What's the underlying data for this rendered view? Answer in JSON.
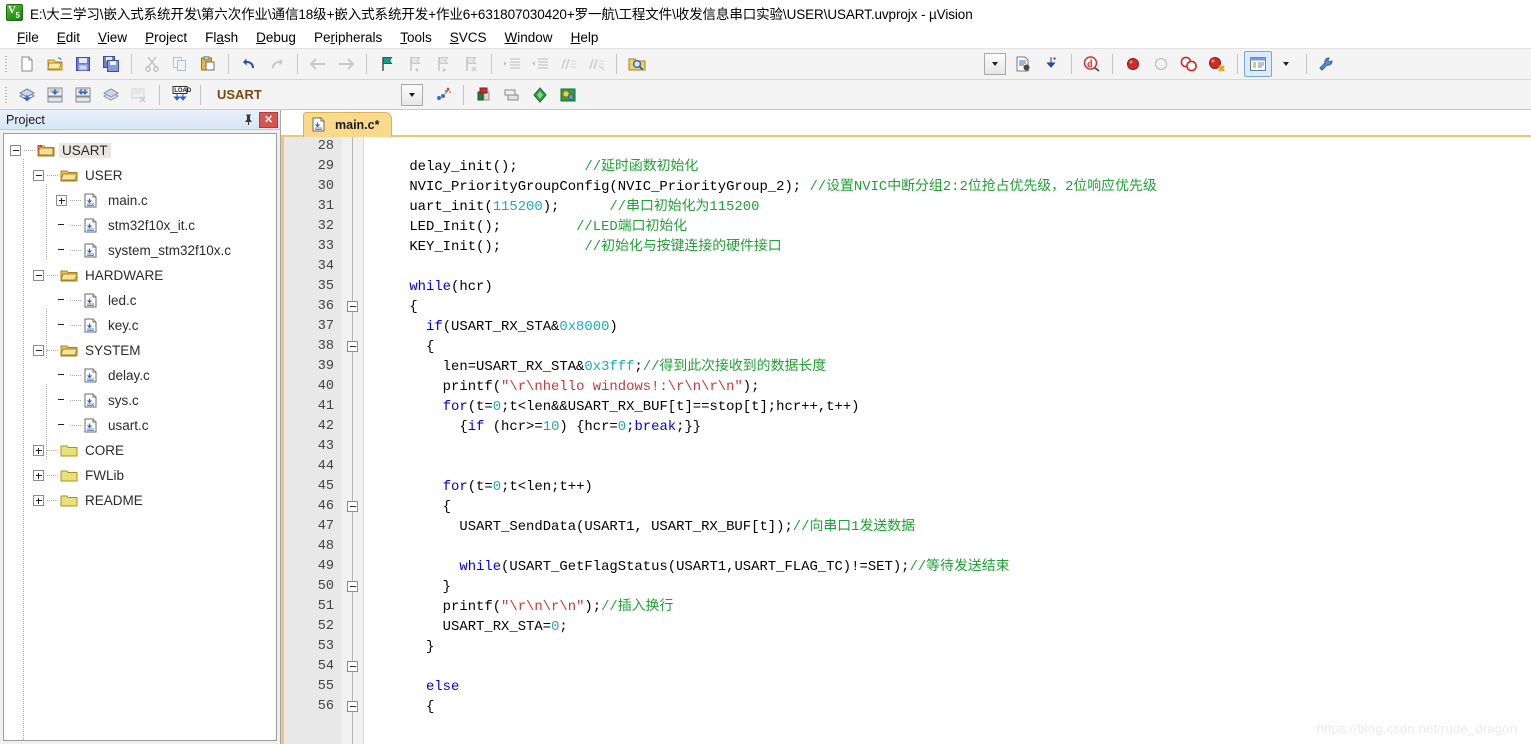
{
  "window": {
    "icon": "uvision-app-icon",
    "title": "E:\\大三学习\\嵌入式系统开发\\第六次作业\\通信18级+嵌入式系统开发+作业6+631807030420+罗一航\\工程文件\\收发信息串口实验\\USER\\USART.uvprojx - µVision"
  },
  "menubar": {
    "items": [
      {
        "label": "File",
        "name": "menu-file"
      },
      {
        "label": "Edit",
        "name": "menu-edit"
      },
      {
        "label": "View",
        "name": "menu-view"
      },
      {
        "label": "Project",
        "name": "menu-project"
      },
      {
        "label": "Flash",
        "name": "menu-flash"
      },
      {
        "label": "Debug",
        "name": "menu-debug"
      },
      {
        "label": "Peripherals",
        "name": "menu-peripherals"
      },
      {
        "label": "Tools",
        "name": "menu-tools"
      },
      {
        "label": "SVCS",
        "name": "menu-svcs"
      },
      {
        "label": "Window",
        "name": "menu-window"
      },
      {
        "label": "Help",
        "name": "menu-help"
      }
    ]
  },
  "toolbar_main": {
    "icons": [
      "new-file-icon",
      "open-file-icon",
      "save-icon",
      "save-all-icon",
      "cut-icon",
      "copy-icon",
      "paste-icon",
      "undo-icon",
      "redo-icon",
      "navigate-back-icon",
      "navigate-forward-icon",
      "bookmark-toggle-icon",
      "bookmark-prev-icon",
      "bookmark-next-icon",
      "bookmark-clear-icon",
      "indent-icon",
      "outdent-icon",
      "comment-icon",
      "uncomment-icon",
      "find-in-files-icon",
      "combo-dropdown-icon",
      "insert-file-icon",
      "configure-icon",
      "debug-session-icon",
      "breakpoint-insert-icon",
      "breakpoint-disable-icon",
      "breakpoint-disable-all-icon",
      "breakpoint-kill-all-icon",
      "project-window-icon",
      "project-window-dropdown-icon",
      "configure-target-icon"
    ]
  },
  "toolbar_build": {
    "icons": [
      "translate-icon",
      "build-target-icon",
      "rebuild-all-icon",
      "batch-build-icon",
      "stop-build-icon",
      "download-icon"
    ],
    "target_value": "USART",
    "target_dropdown": "target-dropdown-icon",
    "after_icons": [
      "target-options-icon",
      "manage-project-items-icon",
      "manage-multi-project-icon",
      "pack-installer-icon",
      "manage-run-time-env-icon"
    ]
  },
  "project_panel": {
    "title": "Project",
    "pin_icon": "pin-icon",
    "close_icon": "close-icon",
    "tree": [
      {
        "label": "USART",
        "depth": 0,
        "type": "project",
        "state": "expanded",
        "selected": true
      },
      {
        "label": "USER",
        "depth": 1,
        "type": "group",
        "state": "expanded",
        "selected": false
      },
      {
        "label": "main.c",
        "depth": 2,
        "type": "file",
        "state": "collapsed",
        "selected": false
      },
      {
        "label": "stm32f10x_it.c",
        "depth": 2,
        "type": "file",
        "state": "leaf",
        "selected": false
      },
      {
        "label": "system_stm32f10x.c",
        "depth": 2,
        "type": "file",
        "state": "leaf",
        "selected": false
      },
      {
        "label": "HARDWARE",
        "depth": 1,
        "type": "group",
        "state": "expanded",
        "selected": false
      },
      {
        "label": "led.c",
        "depth": 2,
        "type": "file",
        "state": "leaf",
        "selected": false
      },
      {
        "label": "key.c",
        "depth": 2,
        "type": "file",
        "state": "leaf",
        "selected": false
      },
      {
        "label": "SYSTEM",
        "depth": 1,
        "type": "group",
        "state": "expanded",
        "selected": false
      },
      {
        "label": "delay.c",
        "depth": 2,
        "type": "file",
        "state": "leaf",
        "selected": false
      },
      {
        "label": "sys.c",
        "depth": 2,
        "type": "file",
        "state": "leaf",
        "selected": false
      },
      {
        "label": "usart.c",
        "depth": 2,
        "type": "file",
        "state": "leaf",
        "selected": false
      },
      {
        "label": "CORE",
        "depth": 1,
        "type": "folder",
        "state": "collapsed",
        "selected": false
      },
      {
        "label": "FWLib",
        "depth": 1,
        "type": "folder",
        "state": "collapsed",
        "selected": false
      },
      {
        "label": "README",
        "depth": 1,
        "type": "folder",
        "state": "collapsed",
        "selected": false
      }
    ]
  },
  "editor": {
    "tabs": [
      {
        "label": "main.c*",
        "icon": "c-file-icon",
        "active": true
      }
    ],
    "first_line_number": 28,
    "fold_lines": [
      36,
      38,
      46,
      50,
      54,
      56
    ],
    "lines": [
      {
        "n": 28,
        "tokens": []
      },
      {
        "n": 29,
        "tokens": [
          {
            "t": "    delay_init();        ",
            "c": "plain"
          },
          {
            "t": "//延时函数初始化",
            "c": "cm"
          }
        ]
      },
      {
        "n": 30,
        "tokens": [
          {
            "t": "    NVIC_PriorityGroupConfig(NVIC_PriorityGroup_2); ",
            "c": "plain"
          },
          {
            "t": "//设置NVIC中断分组2:2位抢占优先级，2位响应优先级",
            "c": "cm"
          }
        ]
      },
      {
        "n": 31,
        "tokens": [
          {
            "t": "    uart_init(",
            "c": "plain"
          },
          {
            "t": "115200",
            "c": "num"
          },
          {
            "t": ");      ",
            "c": "plain"
          },
          {
            "t": "//串口初始化为115200",
            "c": "cm"
          }
        ]
      },
      {
        "n": 32,
        "tokens": [
          {
            "t": "    LED_Init();         ",
            "c": "plain"
          },
          {
            "t": "//LED端口初始化",
            "c": "cm"
          }
        ]
      },
      {
        "n": 33,
        "tokens": [
          {
            "t": "    KEY_Init();          ",
            "c": "plain"
          },
          {
            "t": "//初始化与按键连接的硬件接口",
            "c": "cm"
          }
        ]
      },
      {
        "n": 34,
        "tokens": []
      },
      {
        "n": 35,
        "tokens": [
          {
            "t": "    ",
            "c": "plain"
          },
          {
            "t": "while",
            "c": "kw"
          },
          {
            "t": "(hcr)",
            "c": "plain"
          }
        ]
      },
      {
        "n": 36,
        "tokens": [
          {
            "t": "    {",
            "c": "plain"
          }
        ]
      },
      {
        "n": 37,
        "tokens": [
          {
            "t": "      ",
            "c": "plain"
          },
          {
            "t": "if",
            "c": "kw"
          },
          {
            "t": "(USART_RX_STA&",
            "c": "plain"
          },
          {
            "t": "0x8000",
            "c": "num"
          },
          {
            "t": ")",
            "c": "plain"
          }
        ]
      },
      {
        "n": 38,
        "tokens": [
          {
            "t": "      {",
            "c": "plain"
          }
        ]
      },
      {
        "n": 39,
        "tokens": [
          {
            "t": "        len=USART_RX_STA&",
            "c": "plain"
          },
          {
            "t": "0x3fff",
            "c": "num"
          },
          {
            "t": ";",
            "c": "plain"
          },
          {
            "t": "//得到此次接收到的数据长度",
            "c": "cm"
          }
        ]
      },
      {
        "n": 40,
        "tokens": [
          {
            "t": "        printf(",
            "c": "plain"
          },
          {
            "t": "\"\\r\\nhello windows!:\\r\\n\\r\\n\"",
            "c": "str"
          },
          {
            "t": ");",
            "c": "plain"
          }
        ]
      },
      {
        "n": 41,
        "tokens": [
          {
            "t": "        ",
            "c": "plain"
          },
          {
            "t": "for",
            "c": "kw"
          },
          {
            "t": "(t=",
            "c": "plain"
          },
          {
            "t": "0",
            "c": "num"
          },
          {
            "t": ";t<len&&USART_RX_BUF[t]==stop[t];hcr++,t++)",
            "c": "plain"
          }
        ]
      },
      {
        "n": 42,
        "tokens": [
          {
            "t": "          {",
            "c": "plain"
          },
          {
            "t": "if",
            "c": "kw"
          },
          {
            "t": " (hcr>=",
            "c": "plain"
          },
          {
            "t": "10",
            "c": "num"
          },
          {
            "t": ") {hcr=",
            "c": "plain"
          },
          {
            "t": "0",
            "c": "num"
          },
          {
            "t": ";",
            "c": "plain"
          },
          {
            "t": "break",
            "c": "kw"
          },
          {
            "t": ";}}",
            "c": "plain"
          }
        ]
      },
      {
        "n": 43,
        "tokens": []
      },
      {
        "n": 44,
        "tokens": []
      },
      {
        "n": 45,
        "tokens": [
          {
            "t": "        ",
            "c": "plain"
          },
          {
            "t": "for",
            "c": "kw"
          },
          {
            "t": "(t=",
            "c": "plain"
          },
          {
            "t": "0",
            "c": "num"
          },
          {
            "t": ";t<len;t++)",
            "c": "plain"
          }
        ]
      },
      {
        "n": 46,
        "tokens": [
          {
            "t": "        {",
            "c": "plain"
          }
        ]
      },
      {
        "n": 47,
        "tokens": [
          {
            "t": "          USART_SendData(USART1, USART_RX_BUF[t]);",
            "c": "plain"
          },
          {
            "t": "//向串口1发送数据",
            "c": "cm"
          }
        ]
      },
      {
        "n": 48,
        "tokens": []
      },
      {
        "n": 49,
        "tokens": [
          {
            "t": "          ",
            "c": "plain"
          },
          {
            "t": "while",
            "c": "kw"
          },
          {
            "t": "(USART_GetFlagStatus(USART1,USART_FLAG_TC)!=SET);",
            "c": "plain"
          },
          {
            "t": "//等待发送结束",
            "c": "cm"
          }
        ]
      },
      {
        "n": 50,
        "tokens": [
          {
            "t": "        }",
            "c": "plain"
          }
        ]
      },
      {
        "n": 51,
        "tokens": [
          {
            "t": "        printf(",
            "c": "plain"
          },
          {
            "t": "\"\\r\\n\\r\\n\"",
            "c": "str"
          },
          {
            "t": ");",
            "c": "plain"
          },
          {
            "t": "//插入换行",
            "c": "cm"
          }
        ]
      },
      {
        "n": 52,
        "tokens": [
          {
            "t": "        USART_RX_STA=",
            "c": "plain"
          },
          {
            "t": "0",
            "c": "num"
          },
          {
            "t": ";",
            "c": "plain"
          }
        ]
      },
      {
        "n": 53,
        "tokens": [
          {
            "t": "      }",
            "c": "plain"
          }
        ]
      },
      {
        "n": 54,
        "tokens": []
      },
      {
        "n": 55,
        "tokens": [
          {
            "t": "      ",
            "c": "plain"
          },
          {
            "t": "else",
            "c": "kw"
          }
        ]
      },
      {
        "n": 56,
        "tokens": [
          {
            "t": "      {",
            "c": "plain"
          }
        ]
      }
    ]
  },
  "watermark": {
    "text": "https://blog.csdn.net/rude_dragon"
  },
  "colors": {
    "tab_active": "#fbd98a",
    "comment": "#21a036",
    "keyword": "#0000e0",
    "number": "#1da8c4",
    "string": "#c43a3a",
    "panel_header": "#d8e6f5",
    "close_button": "#d9534f",
    "target_text": "#7a4a10"
  }
}
